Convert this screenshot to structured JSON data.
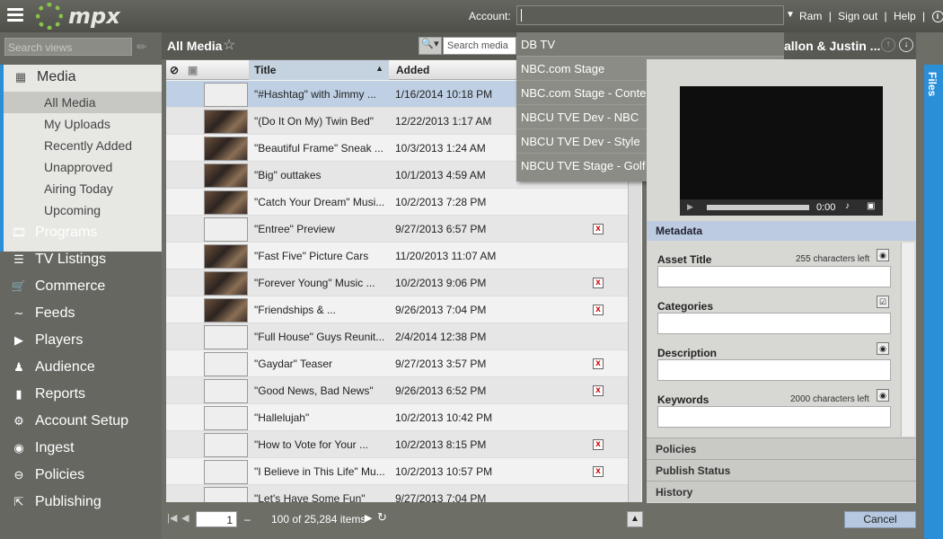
{
  "app": {
    "logo_text": "mpx"
  },
  "topbar": {
    "account_label": "Account:",
    "account_value": "",
    "links": [
      "Ram",
      "|",
      "Sign out",
      "|",
      "Help",
      "|"
    ]
  },
  "sidebar": {
    "search_placeholder": "Search views",
    "media": {
      "label": "Media",
      "items": [
        "All Media",
        "My Uploads",
        "Recently Added",
        "Unapproved",
        "Airing Today",
        "Upcoming"
      ],
      "selected": "All Media"
    },
    "nav": [
      {
        "label": "Programs",
        "icon": "film-icon"
      },
      {
        "label": "TV Listings",
        "icon": "list-icon"
      },
      {
        "label": "Commerce",
        "icon": "cart-icon"
      },
      {
        "label": "Feeds",
        "icon": "rss-icon"
      },
      {
        "label": "Players",
        "icon": "player-icon"
      },
      {
        "label": "Audience",
        "icon": "audience-icon"
      },
      {
        "label": "Reports",
        "icon": "bar-chart-icon"
      },
      {
        "label": "Account Setup",
        "icon": "gear-icon"
      },
      {
        "label": "Ingest",
        "icon": "camera-icon"
      },
      {
        "label": "Policies",
        "icon": "minus-circle-icon"
      },
      {
        "label": "Publishing",
        "icon": "publish-icon"
      }
    ]
  },
  "list": {
    "title": "All Media",
    "search_placeholder": "Search media",
    "columns": [
      "Title",
      "Added"
    ],
    "rows": [
      {
        "title": "\"#Hashtag\" with Jimmy ...",
        "added": "1/16/2014 10:18 PM",
        "thumb": false,
        "flag": false
      },
      {
        "title": "\"(Do It On My) Twin Bed\"",
        "added": "12/22/2013 1:17 AM",
        "thumb": true,
        "flag": false
      },
      {
        "title": "\"Beautiful Frame\" Sneak ...",
        "added": "10/3/2013 1:24 AM",
        "thumb": true,
        "flag": false
      },
      {
        "title": "\"Big\" outtakes",
        "added": "10/1/2013 4:59 AM",
        "thumb": true,
        "flag": false
      },
      {
        "title": "\"Catch Your Dream\" Musi...",
        "added": "10/2/2013 7:28 PM",
        "thumb": true,
        "flag": false
      },
      {
        "title": "\"Entree\" Preview",
        "added": "9/27/2013 6:57 PM",
        "thumb": false,
        "flag": true
      },
      {
        "title": "\"Fast Five\" Picture Cars",
        "added": "11/20/2013 11:07 AM",
        "thumb": true,
        "flag": false
      },
      {
        "title": "\"Forever Young\" Music ...",
        "added": "10/2/2013 9:06 PM",
        "thumb": true,
        "flag": true
      },
      {
        "title": "\"Friendships & ...",
        "added": "9/26/2013 7:04 PM",
        "thumb": true,
        "flag": true
      },
      {
        "title": "\"Full House\" Guys Reunit...",
        "added": "2/4/2014 12:38 PM",
        "thumb": false,
        "flag": false
      },
      {
        "title": "\"Gaydar\" Teaser",
        "added": "9/27/2013 3:57 PM",
        "thumb": false,
        "flag": true
      },
      {
        "title": "\"Good News, Bad News\"",
        "added": "9/26/2013 6:52 PM",
        "thumb": false,
        "flag": true
      },
      {
        "title": "\"Hallelujah\"",
        "added": "10/2/2013 10:42 PM",
        "thumb": false,
        "flag": false
      },
      {
        "title": "\"How to Vote for Your ...",
        "added": "10/2/2013 8:15 PM",
        "thumb": false,
        "flag": true
      },
      {
        "title": "\"I Believe in This Life\" Mu...",
        "added": "10/2/2013 10:57 PM",
        "thumb": false,
        "flag": true
      },
      {
        "title": "\"Let's Have Some Fun\"",
        "added": "9/27/2013 7:04 PM",
        "thumb": false,
        "flag": false
      }
    ],
    "page": "1",
    "dash": "–",
    "count_text": "100 of 25,284 items"
  },
  "account_dropdown": [
    "DB TV",
    "NBC.com Stage",
    "NBC.com Stage - Content Testing",
    "NBCU TVE Dev - NBC",
    "NBCU TVE Dev - Style",
    "NBCU TVE Stage - Golf Channel"
  ],
  "detail": {
    "title": "allon & Justin ...",
    "files_tab": "Files",
    "video_time": "0:00",
    "metadata_label": "Metadata",
    "fields": [
      {
        "label": "Asset Title",
        "note": "255 characters left"
      },
      {
        "label": "Categories",
        "note": ""
      },
      {
        "label": "Description",
        "note": ""
      },
      {
        "label": "Keywords",
        "note": "2000 characters left"
      }
    ],
    "sections": [
      "Policies",
      "Publish Status",
      "History"
    ],
    "cancel_label": "Cancel"
  }
}
